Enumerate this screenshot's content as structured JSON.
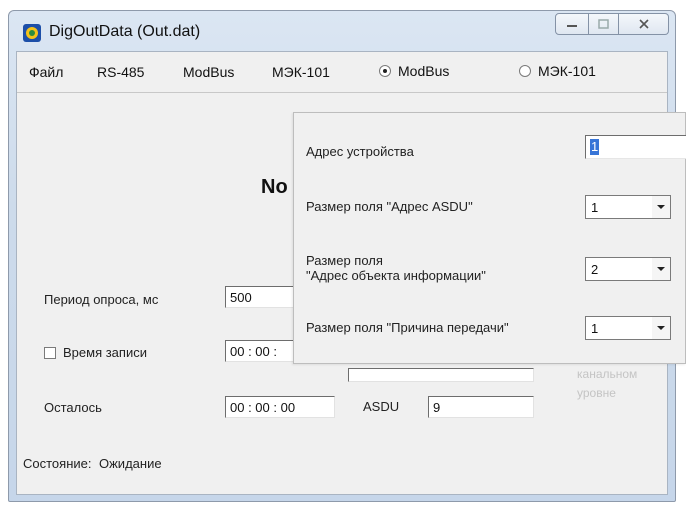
{
  "window": {
    "title": "DigOutData (Out.dat)"
  },
  "menu": {
    "items": [
      "Файл",
      "RS-485",
      "ModBus",
      "МЭК-101"
    ],
    "radio_modbus": "ModBus",
    "radio_iec": "МЭК-101"
  },
  "main": {
    "no_label": "No",
    "period_label": "Период опроса, мс",
    "period_value": "500",
    "record_time_label": "Время записи",
    "record_time_value": "00 : 00 :",
    "remaining_label": "Осталось",
    "remaining_value": "00 : 00 : 00",
    "asdu_label": "ASDU",
    "asdu_value": "9",
    "status_label": "Состояние:",
    "status_value": "Ожидание",
    "ghost_line1": "канальном",
    "ghost_line2": "уровне"
  },
  "popup": {
    "device_address_label": "Адрес устройства",
    "device_address_value": "1",
    "asdu_size_label": "Размер поля \"Адрес ASDU\"",
    "asdu_size_value": "1",
    "info_obj_label_1": "Размер поля",
    "info_obj_label_2": "\"Адрес объекта информации\"",
    "info_obj_value": "2",
    "cause_label": "Размер поля \"Причина передачи\"",
    "cause_value": "1"
  }
}
